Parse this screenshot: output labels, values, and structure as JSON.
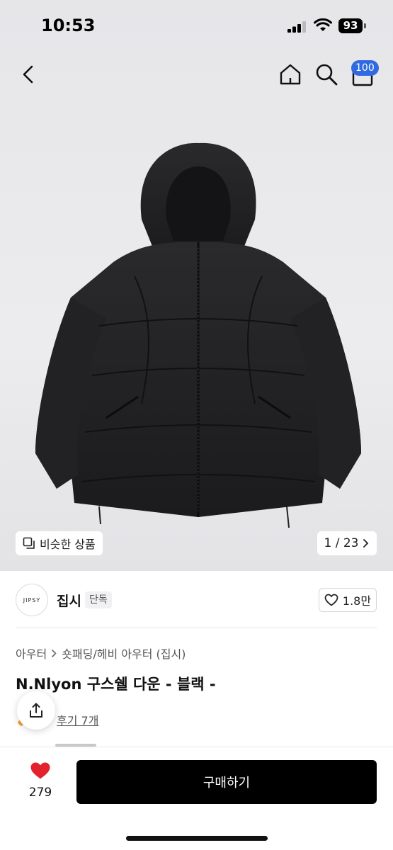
{
  "status_bar": {
    "time": "10:53",
    "battery": "93"
  },
  "nav": {
    "cart_count": "100"
  },
  "gallery": {
    "similar_label": "비슷한 상품",
    "counter": "1 / 23"
  },
  "brand": {
    "logo_text": "JIPSY",
    "name": "집시",
    "tag": "단독",
    "likes": "1.8만"
  },
  "breadcrumb": {
    "category": "아우터",
    "subcategory": "숏패딩/헤비 아우터 (집시)"
  },
  "product": {
    "title": "N.Nlyon 구스쉘 다운 - 블랙 -",
    "review_link": "후기 7개"
  },
  "bottom": {
    "wish_count": "279",
    "buy_label": "구매하기"
  },
  "colors": {
    "accent": "#2f6ae0",
    "wish_red": "#e2222c",
    "buy_bg": "#000000"
  }
}
